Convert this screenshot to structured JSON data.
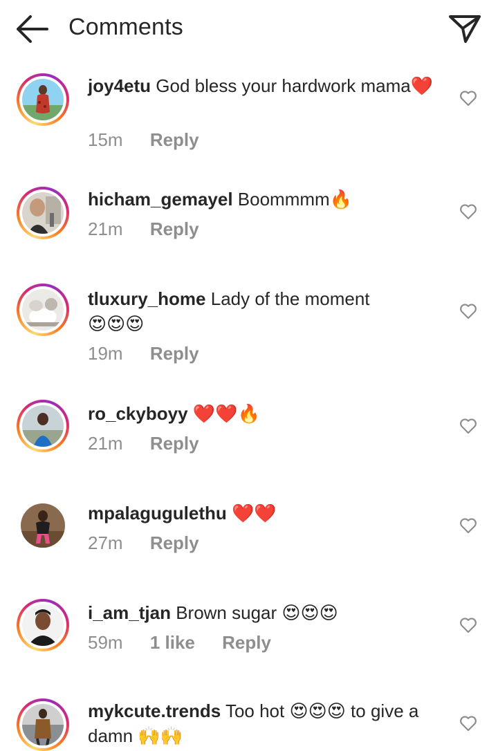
{
  "header": {
    "title": "Comments"
  },
  "icons": {
    "back": "arrow-left-icon",
    "share": "paper-plane-icon",
    "like": "heart-outline-icon"
  },
  "colors": {
    "text": "#262626",
    "muted": "#8e8e8e",
    "story_ring": [
      "#feda75",
      "#fa7e1e",
      "#d62976",
      "#962fbf"
    ]
  },
  "comments": [
    {
      "username": "joy4etu",
      "text": "God bless your hardwork mama",
      "emoji": "❤️",
      "time": "15m",
      "likes": "",
      "reply": "Reply",
      "story_ring": true
    },
    {
      "username": "hicham_gemayel",
      "text": "Boommmm",
      "emoji": "🔥",
      "time": "21m",
      "likes": "",
      "reply": "Reply",
      "story_ring": true
    },
    {
      "username": "tluxury_home",
      "text": "Lady of the moment",
      "emoji": "😍😍😍",
      "time": "19m",
      "likes": "",
      "reply": "Reply",
      "story_ring": true
    },
    {
      "username": "ro_ckyboyy",
      "text": "",
      "emoji": "❤️❤️🔥",
      "time": "21m",
      "likes": "",
      "reply": "Reply",
      "story_ring": true
    },
    {
      "username": "mpalagugulethu",
      "text": "",
      "emoji": "❤️❤️",
      "time": "27m",
      "likes": "",
      "reply": "Reply",
      "story_ring": false
    },
    {
      "username": "i_am_tjan",
      "text": "Brown sugar",
      "emoji": "😍😍😍",
      "time": "59m",
      "likes": "1 like",
      "reply": "Reply",
      "story_ring": true
    },
    {
      "username": "mykcute.trends",
      "text": "Too hot",
      "emoji": "😍😍😍",
      "text2": "to give a damn",
      "emoji2": "🙌🙌",
      "time": "",
      "likes": "",
      "reply": "",
      "story_ring": true
    }
  ]
}
